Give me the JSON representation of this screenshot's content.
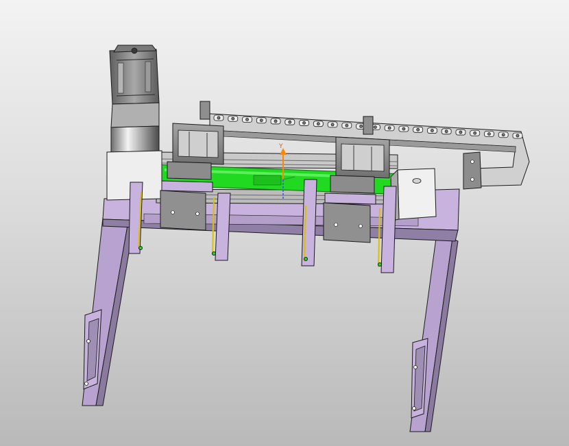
{
  "viewport": {
    "background_top": "#f3f3f3",
    "background_bottom": "#b9b9b9"
  },
  "colors": {
    "frame": "#c8b2de",
    "frame_shadow": "#8a7a9e",
    "metal": "#8c8c8c",
    "metal_dark": "#5a5a5a",
    "metal_light": "#d9d9d9",
    "highlight": "#22d922",
    "outline": "#1a1a1a",
    "axis_y": "#ff8800",
    "axis_x": "#2ba02b",
    "axis_z": "#3355ee"
  },
  "triad": {
    "y_label": "Y",
    "icon": "coordinate-triad-icon"
  },
  "model": {
    "icon": "cad-assembly-icon"
  }
}
